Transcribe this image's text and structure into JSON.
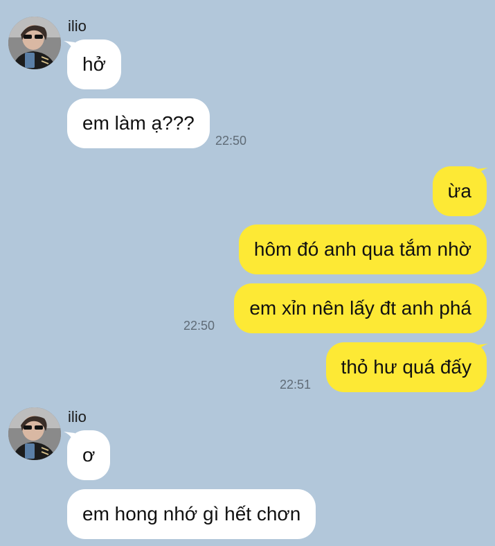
{
  "contact": {
    "name": "ilio"
  },
  "groups": [
    {
      "sender": "ilio",
      "messages": [
        "hở",
        "em làm ạ???"
      ],
      "time": "22:50"
    },
    {
      "sender": "me",
      "messages": [
        "ừa",
        "hôm đó anh qua tắm nhờ",
        "em xỉn nên lấy đt anh phá"
      ],
      "time": "22:50"
    },
    {
      "sender": "me",
      "messages": [
        "thỏ hư quá đấy"
      ],
      "time": "22:51"
    },
    {
      "sender": "ilio",
      "messages": [
        "ơ",
        "em hong nhớ gì hết chơn"
      ]
    }
  ],
  "colors": {
    "background": "#b2c7da",
    "incoming": "#ffffff",
    "outgoing": "#fde935"
  }
}
